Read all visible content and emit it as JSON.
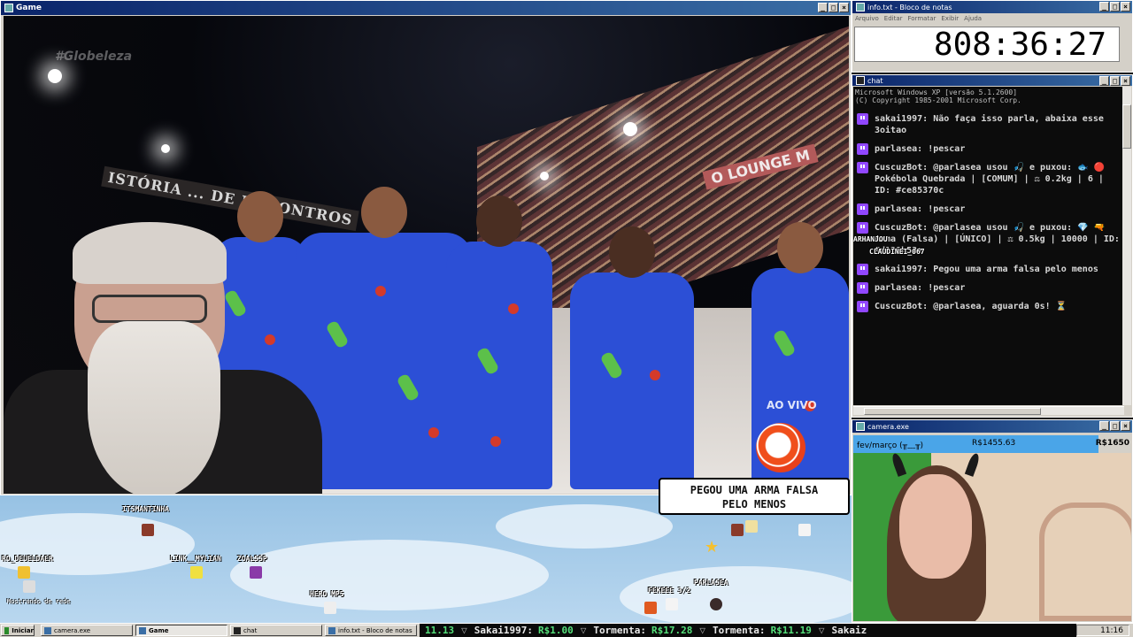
{
  "game_window": {
    "title": "Game",
    "broadcast": {
      "watermark": "#Globeleza",
      "banner_text": "ISTÓRIA ... DE ENCONTROS",
      "lounge_text": "O LOUNGE M",
      "live_text": "AO VIVO"
    }
  },
  "speech_bubble": {
    "line1": "PEGOU UMA ARMA FALSA",
    "line2": "PELO MENOS"
  },
  "overlay_users": [
    {
      "name": "ITSMANTINHA"
    },
    {
      "name": "RO_DEUELDAER"
    },
    {
      "name": "LINK__MYLIAN"
    },
    {
      "name": "ZOALSSP"
    },
    {
      "name": "HERO MP5"
    },
    {
      "name": "FEKEEE 3/2"
    },
    {
      "name": "PARLASEA"
    }
  ],
  "overlay_caption": "Mostrando de rede",
  "info_window": {
    "title": "info.txt - Bloco de notas",
    "menu": [
      "Arquivo",
      "Editar",
      "Formatar",
      "Exibir",
      "Ajuda"
    ],
    "timer": "808:36:27"
  },
  "chat_window": {
    "title": "chat",
    "header_line1": "Microsoft Windows XP [versão 5.1.2600]",
    "header_line2": "(C) Copyright 1985-2001 Microsoft Corp.",
    "messages": [
      {
        "text": "sakai1997: Não faça isso parla, abaixa esse 3oitao"
      },
      {
        "text": "parlasea: !pescar"
      },
      {
        "text": "CuscuzBot: @parlasea usou 🎣 e puxou: 🐟 🔴 Pokébola Quebrada | [COMUM] | ⚖ 0.2kg | 6 | ID: #ce85370c"
      },
      {
        "text": "parlasea: !pescar"
      },
      {
        "text": "CuscuzBot: @parlasea usou 🎣 e puxou: 💎 🔫 Arma (Falsa) | [ÚNICO] | ⚖ 0.5kg | 10000 | ID: #d129b53e"
      },
      {
        "text": "sakai1997: Pegou uma arma falsa pelo menos"
      },
      {
        "text": "parlasea: !pescar"
      },
      {
        "text": "CuscuzBot: @parlasea, aguarda 0s! ⏳"
      }
    ],
    "floating_names": [
      "ARHANJOU",
      "CLAUDINEI_067"
    ]
  },
  "camera_window": {
    "title": "camera.exe",
    "budget_label": "fev/março (╥﹏╥)",
    "budget_current": "R$1455.63",
    "budget_goal": "R$1650",
    "budget_fraction": 0.882
  },
  "taskbar": {
    "start_label": "Iniciar",
    "items": [
      {
        "label": "camera.exe"
      },
      {
        "label": "Game"
      },
      {
        "label": "chat"
      },
      {
        "label": "info.txt - Bloco de notas"
      }
    ],
    "ticker": [
      {
        "name": "",
        "value": "11.13"
      },
      {
        "name": "Sakai1997:",
        "value": "R$1.00"
      },
      {
        "name": "Tormenta:",
        "value": "R$17.28"
      },
      {
        "name": "Tormenta:",
        "value": "R$11.19"
      },
      {
        "name": "Sakaiz",
        "value": ""
      }
    ],
    "clock": "11:16"
  },
  "colors": {
    "titlebar": "#0a246a",
    "accent_purple": "#9147ff",
    "ticker_value": "#55e07a",
    "budget_fill": "#4aa5e8"
  }
}
